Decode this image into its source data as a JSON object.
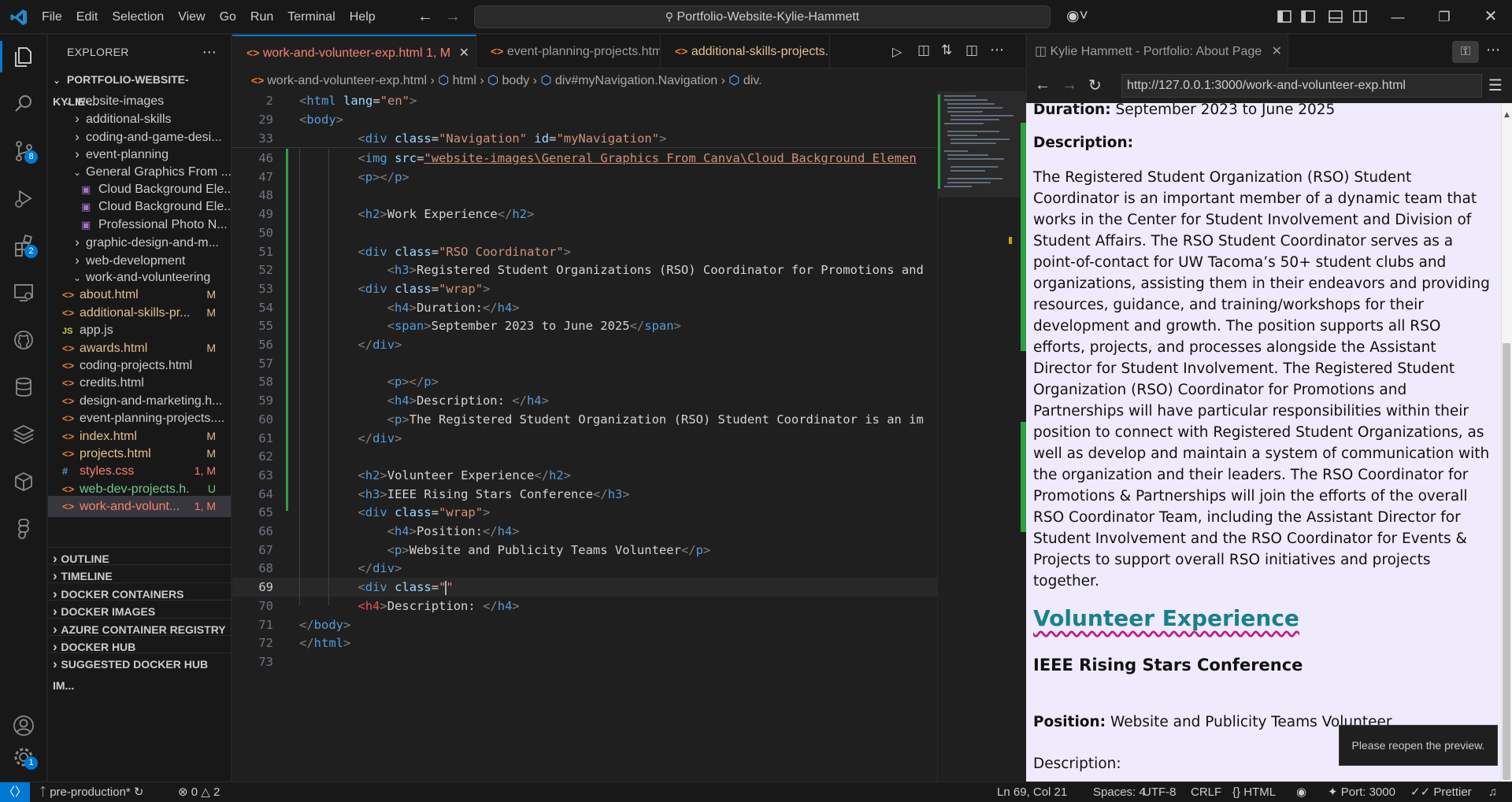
{
  "titlebar": {
    "menu": [
      "File",
      "Edit",
      "Selection",
      "View",
      "Go",
      "Run",
      "Terminal",
      "Help"
    ],
    "command_center": "Portfolio-Website-Kylie-Hammett"
  },
  "activity": {
    "scm_badge": "8",
    "extensions_badge": "2",
    "settings_badge": "1"
  },
  "sidebar": {
    "title": "EXPLORER",
    "root": "PORTFOLIO-WEBSITE-KYLIE-...",
    "tree": [
      {
        "label": "website-images",
        "kind": "folder-open",
        "indent": 1
      },
      {
        "label": "additional-skills",
        "kind": "folder",
        "indent": 2
      },
      {
        "label": "coding-and-game-desi...",
        "kind": "folder",
        "indent": 2
      },
      {
        "label": "event-planning",
        "kind": "folder",
        "indent": 2
      },
      {
        "label": "General Graphics From ...",
        "kind": "folder-open",
        "indent": 2
      },
      {
        "label": "Cloud Background Ele...",
        "kind": "image",
        "indent": 3
      },
      {
        "label": "Cloud Background Ele...",
        "kind": "image",
        "indent": 3
      },
      {
        "label": "Professional Photo N...",
        "kind": "image",
        "indent": 3
      },
      {
        "label": "graphic-design-and-m...",
        "kind": "folder",
        "indent": 2
      },
      {
        "label": "web-development",
        "kind": "folder",
        "indent": 2
      },
      {
        "label": "work-and-volunteering",
        "kind": "folder-open",
        "indent": 2
      },
      {
        "label": "about.html",
        "kind": "html",
        "indent": 1,
        "status": "M"
      },
      {
        "label": "additional-skills-pr...",
        "kind": "html",
        "indent": 1,
        "status": "M"
      },
      {
        "label": "app.js",
        "kind": "js",
        "indent": 1
      },
      {
        "label": "awards.html",
        "kind": "html",
        "indent": 1,
        "status": "M"
      },
      {
        "label": "coding-projects.html",
        "kind": "html",
        "indent": 1
      },
      {
        "label": "credits.html",
        "kind": "html",
        "indent": 1
      },
      {
        "label": "design-and-marketing.h...",
        "kind": "html",
        "indent": 1
      },
      {
        "label": "event-planning-projects....",
        "kind": "html",
        "indent": 1
      },
      {
        "label": "index.html",
        "kind": "html",
        "indent": 1,
        "status": "M"
      },
      {
        "label": "projects.html",
        "kind": "html",
        "indent": 1,
        "status": "M"
      },
      {
        "label": "styles.css",
        "kind": "css",
        "indent": 1,
        "status": "1, M"
      },
      {
        "label": "web-dev-projects.h...",
        "kind": "html",
        "indent": 1,
        "status": "U"
      },
      {
        "label": "work-and-volunt...",
        "kind": "html",
        "indent": 1,
        "status": "1, M",
        "selected": true
      }
    ],
    "sections": [
      "OUTLINE",
      "TIMELINE",
      "DOCKER CONTAINERS",
      "DOCKER IMAGES",
      "AZURE CONTAINER REGISTRY",
      "DOCKER HUB",
      "SUGGESTED DOCKER HUB IM..."
    ]
  },
  "editor": {
    "tabs": [
      {
        "label": "work-and-volunteer-exp.html",
        "status": "1, M",
        "active": true
      },
      {
        "label": "event-planning-projects.html",
        "active": false
      },
      {
        "label": "additional-skills-projects.h",
        "active": false
      }
    ],
    "breadcrumb": [
      "work-and-volunteer-exp.html",
      "html",
      "body",
      "div#myNavigation.Navigation",
      "div."
    ],
    "sticky": [
      {
        "n": "2",
        "indent": 0,
        "parts": [
          [
            "brk",
            "<"
          ],
          [
            "tag",
            "html"
          ],
          [
            "txt",
            " "
          ],
          [
            "attr",
            "lang"
          ],
          [
            "txt",
            "="
          ],
          [
            "str",
            "\"en\""
          ],
          [
            "brk",
            ">"
          ]
        ]
      },
      {
        "n": "29",
        "indent": 0,
        "parts": [
          [
            "brk",
            "<"
          ],
          [
            "tag",
            "body"
          ],
          [
            "brk",
            ">"
          ]
        ]
      },
      {
        "n": "33",
        "indent": 2,
        "parts": [
          [
            "brk",
            "<"
          ],
          [
            "tag",
            "div"
          ],
          [
            "txt",
            " "
          ],
          [
            "attr",
            "class"
          ],
          [
            "txt",
            "="
          ],
          [
            "str",
            "\"Navigation\""
          ],
          [
            "txt",
            " "
          ],
          [
            "attr",
            "id"
          ],
          [
            "txt",
            "="
          ],
          [
            "str",
            "\"myNavigation\""
          ],
          [
            "brk",
            ">"
          ]
        ]
      }
    ],
    "lines": [
      {
        "n": "46",
        "indent": 2,
        "parts": [
          [
            "brk",
            "<"
          ],
          [
            "tag",
            "img"
          ],
          [
            "txt",
            " "
          ],
          [
            "attr",
            "src"
          ],
          [
            "txt",
            "="
          ],
          [
            "str",
            "\"website-images\\General Graphics From Canva\\Cloud Background Elemen"
          ]
        ]
      },
      {
        "n": "47",
        "indent": 2,
        "parts": [
          [
            "brk",
            "<"
          ],
          [
            "tag",
            "p"
          ],
          [
            "brk",
            "></"
          ],
          [
            "tag",
            "p"
          ],
          [
            "brk",
            ">"
          ]
        ]
      },
      {
        "n": "48",
        "indent": 0,
        "parts": []
      },
      {
        "n": "49",
        "indent": 2,
        "parts": [
          [
            "brk",
            "<"
          ],
          [
            "tag",
            "h2"
          ],
          [
            "brk",
            ">"
          ],
          [
            "txt",
            "Work Experience"
          ],
          [
            "brk",
            "</"
          ],
          [
            "tag",
            "h2"
          ],
          [
            "brk",
            ">"
          ]
        ]
      },
      {
        "n": "50",
        "indent": 0,
        "parts": []
      },
      {
        "n": "51",
        "indent": 2,
        "parts": [
          [
            "brk",
            "<"
          ],
          [
            "tag",
            "div"
          ],
          [
            "txt",
            " "
          ],
          [
            "attr",
            "class"
          ],
          [
            "txt",
            "="
          ],
          [
            "str",
            "\"RSO Coordinator\""
          ],
          [
            "brk",
            ">"
          ]
        ]
      },
      {
        "n": "52",
        "indent": 3,
        "parts": [
          [
            "brk",
            "<"
          ],
          [
            "tag",
            "h3"
          ],
          [
            "brk",
            ">"
          ],
          [
            "txt",
            "Registered Student Organizations (RSO) Coordinator for Promotions and"
          ]
        ]
      },
      {
        "n": "53",
        "indent": 2,
        "parts": [
          [
            "brk",
            "<"
          ],
          [
            "tag",
            "div"
          ],
          [
            "txt",
            " "
          ],
          [
            "attr",
            "class"
          ],
          [
            "txt",
            "="
          ],
          [
            "str",
            "\"wrap\""
          ],
          [
            "brk",
            ">"
          ]
        ]
      },
      {
        "n": "54",
        "indent": 3,
        "parts": [
          [
            "brk",
            "<"
          ],
          [
            "tag",
            "h4"
          ],
          [
            "brk",
            ">"
          ],
          [
            "txt",
            "Duration:"
          ],
          [
            "brk",
            "</"
          ],
          [
            "tag",
            "h4"
          ],
          [
            "brk",
            ">"
          ]
        ]
      },
      {
        "n": "55",
        "indent": 3,
        "parts": [
          [
            "brk",
            "<"
          ],
          [
            "tag",
            "span"
          ],
          [
            "brk",
            ">"
          ],
          [
            "txt",
            "September 2023 to June 2025"
          ],
          [
            "brk",
            "</"
          ],
          [
            "tag",
            "span"
          ],
          [
            "brk",
            ">"
          ]
        ]
      },
      {
        "n": "56",
        "indent": 2,
        "parts": [
          [
            "brk",
            "</"
          ],
          [
            "tag",
            "div"
          ],
          [
            "brk",
            ">"
          ]
        ]
      },
      {
        "n": "57",
        "indent": 0,
        "parts": []
      },
      {
        "n": "58",
        "indent": 3,
        "parts": [
          [
            "brk",
            "<"
          ],
          [
            "tag",
            "p"
          ],
          [
            "brk",
            "></"
          ],
          [
            "tag",
            "p"
          ],
          [
            "brk",
            ">"
          ]
        ]
      },
      {
        "n": "59",
        "indent": 3,
        "parts": [
          [
            "brk",
            "<"
          ],
          [
            "tag",
            "h4"
          ],
          [
            "brk",
            ">"
          ],
          [
            "txt",
            "Description: "
          ],
          [
            "brk",
            "</"
          ],
          [
            "tag",
            "h4"
          ],
          [
            "brk",
            ">"
          ]
        ]
      },
      {
        "n": "60",
        "indent": 3,
        "parts": [
          [
            "brk",
            "<"
          ],
          [
            "tag",
            "p"
          ],
          [
            "brk",
            ">"
          ],
          [
            "txt",
            "The Registered Student Organization (RSO) Student Coordinator is an im"
          ]
        ]
      },
      {
        "n": "61",
        "indent": 2,
        "parts": [
          [
            "brk",
            "</"
          ],
          [
            "tag",
            "div"
          ],
          [
            "brk",
            ">"
          ]
        ]
      },
      {
        "n": "62",
        "indent": 0,
        "parts": []
      },
      {
        "n": "63",
        "indent": 2,
        "parts": [
          [
            "brk",
            "<"
          ],
          [
            "tag",
            "h2"
          ],
          [
            "brk",
            ">"
          ],
          [
            "txt",
            "Volunteer Experience"
          ],
          [
            "brk",
            "</"
          ],
          [
            "tag",
            "h2"
          ],
          [
            "brk",
            ">"
          ]
        ]
      },
      {
        "n": "64",
        "indent": 2,
        "parts": [
          [
            "brk",
            "<"
          ],
          [
            "tag",
            "h3"
          ],
          [
            "brk",
            ">"
          ],
          [
            "txt",
            "IEEE Rising Stars Conference"
          ],
          [
            "brk",
            "</"
          ],
          [
            "tag",
            "h3"
          ],
          [
            "brk",
            ">"
          ]
        ]
      },
      {
        "n": "65",
        "indent": 2,
        "parts": [
          [
            "brk",
            "<"
          ],
          [
            "tag",
            "div"
          ],
          [
            "txt",
            " "
          ],
          [
            "attr",
            "class"
          ],
          [
            "txt",
            "="
          ],
          [
            "str",
            "\"wrap\""
          ],
          [
            "brk",
            ">"
          ]
        ]
      },
      {
        "n": "66",
        "indent": 3,
        "parts": [
          [
            "brk",
            "<"
          ],
          [
            "tag",
            "h4"
          ],
          [
            "brk",
            ">"
          ],
          [
            "txt",
            "Position:"
          ],
          [
            "brk",
            "</"
          ],
          [
            "tag",
            "h4"
          ],
          [
            "brk",
            ">"
          ]
        ]
      },
      {
        "n": "67",
        "indent": 3,
        "parts": [
          [
            "brk",
            "<"
          ],
          [
            "tag",
            "p"
          ],
          [
            "brk",
            ">"
          ],
          [
            "txt",
            "Website and Publicity Teams Volunteer"
          ],
          [
            "brk",
            "</"
          ],
          [
            "tag",
            "p"
          ],
          [
            "brk",
            ">"
          ]
        ]
      },
      {
        "n": "68",
        "indent": 2,
        "parts": [
          [
            "brk",
            "</"
          ],
          [
            "tag",
            "div"
          ],
          [
            "brk",
            ">"
          ]
        ]
      },
      {
        "n": "69",
        "indent": 2,
        "parts": [
          [
            "brk",
            "<"
          ],
          [
            "tag",
            "div"
          ],
          [
            "txt",
            " "
          ],
          [
            "attr",
            "class"
          ],
          [
            "txt",
            "="
          ],
          [
            "str",
            "\"\""
          ]
        ],
        "current": true
      },
      {
        "n": "70",
        "indent": 2,
        "parts": [
          [
            "err",
            "<h4"
          ],
          [
            "brk",
            ">"
          ],
          [
            "txt",
            "Description: "
          ],
          [
            "brk",
            "</"
          ],
          [
            "tag",
            "h4"
          ],
          [
            "brk",
            ">"
          ]
        ]
      },
      {
        "n": "71",
        "indent": 0,
        "parts": [
          [
            "brk",
            "</"
          ],
          [
            "tag",
            "body"
          ],
          [
            "brk",
            ">"
          ]
        ]
      },
      {
        "n": "72",
        "indent": 0,
        "parts": [
          [
            "brk",
            "</"
          ],
          [
            "tag",
            "html"
          ],
          [
            "brk",
            ">"
          ]
        ]
      },
      {
        "n": "73",
        "indent": 0,
        "parts": []
      }
    ]
  },
  "preview": {
    "tab_title": "Kylie Hammett - Portfolio: About Page",
    "url": "http://127.0.0.1:3000/work-and-volunteer-exp.html",
    "duration_label": "Duration:",
    "duration_value": "September 2023 to June 2025",
    "description_label": "Description:",
    "description_text": "The Registered Student Organization (RSO) Student Coordinator is an important member of a dynamic team that works in the Center for Student Involvement and Division of Student Affairs. The RSO Student Coordinator serves as a point-of-contact for UW Tacoma’s 50+ student clubs and organizations, assisting them in their endeavors and providing resources, guidance, and training/workshops for their development and growth. The position supports all RSO efforts, projects, and processes alongside the Assistant Director for Student Involvement. The Registered Student Organization (RSO) Coordinator for Promotions and Partnerships will have particular responsibilities within their position to connect with Registered Student Organizations, as well as develop and maintain a system of communication with the organization and their leaders. The RSO Coordinator for Promotions & Partnerships will join the efforts of the overall RSO Coordinator Team, including the Assistant Director for Student Involvement and the RSO Coordinator for Events & Projects to support overall RSO initiatives and projects together.",
    "volunteer_heading": "Volunteer Experience",
    "conference_heading": "IEEE Rising Stars Conference",
    "position_label": "Position:",
    "position_value": "Website and Publicity Teams Volunteer",
    "description2_label": "Description:",
    "toast": "Please reopen the preview."
  },
  "statusbar": {
    "branch": "pre-production*",
    "errors": "0",
    "warnings": "2",
    "cursor": "Ln 69, Col 21",
    "spaces": "Spaces: 4",
    "encoding": "UTF-8",
    "eol": "CRLF",
    "language": "HTML",
    "port": "Port: 3000",
    "formatter": "Prettier"
  },
  "colors": {
    "accent": "#0078d4",
    "modified": "#e2c08d",
    "untracked": "#73c991",
    "error_file": "#f88070",
    "link_heading": "#1a7f8c"
  }
}
